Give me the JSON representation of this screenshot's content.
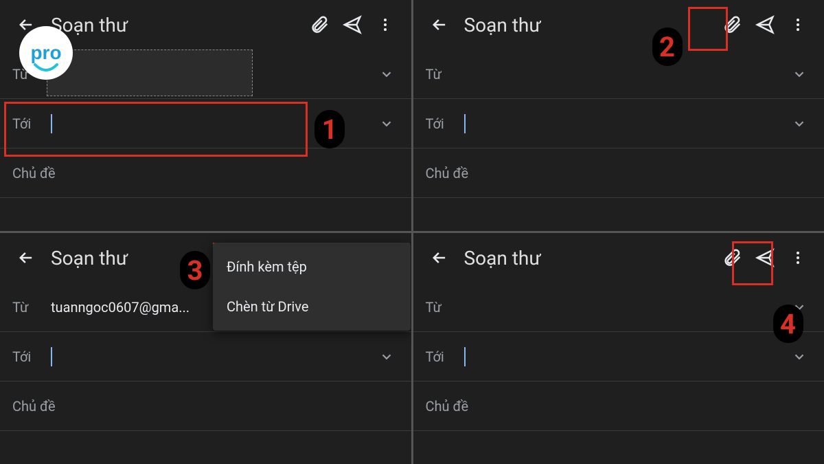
{
  "compose_title": "Soạn thư",
  "labels": {
    "from": "Từ",
    "to": "Tới",
    "subject": "Chủ đề"
  },
  "panel3": {
    "from_value": "tuanngoc0607@gma..."
  },
  "menu": {
    "attach_file": "Đính kèm tệp",
    "insert_drive": "Chèn từ Drive"
  },
  "steps": {
    "s1": "1",
    "s2": "2",
    "s3": "3",
    "s4": "4"
  },
  "logo_text": "pro"
}
